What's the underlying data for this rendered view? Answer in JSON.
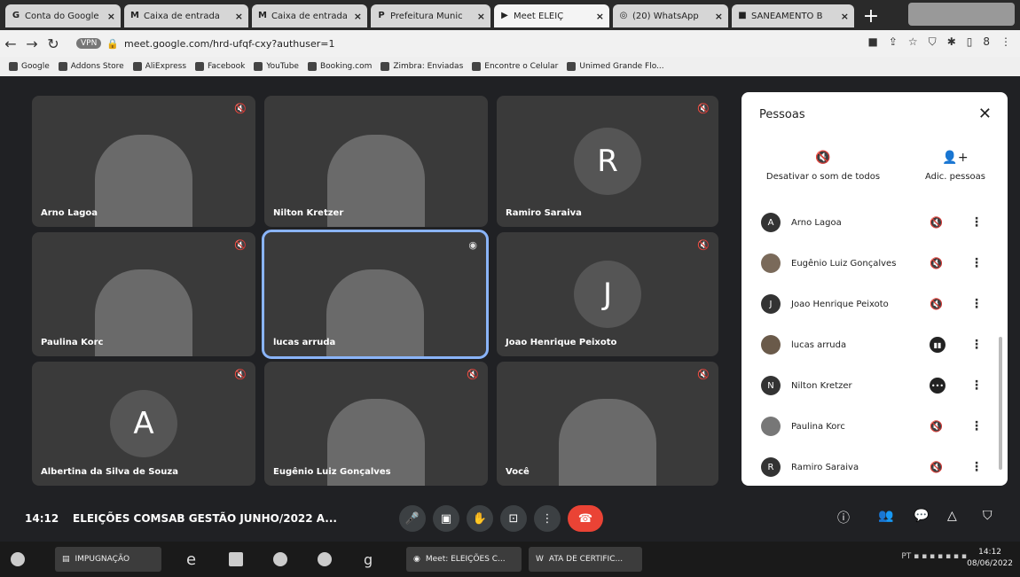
{
  "tabs": [
    {
      "label": "Conta do Google",
      "icon": "G",
      "active": false
    },
    {
      "label": "Caixa de entrada",
      "icon": "M",
      "active": false
    },
    {
      "label": "Caixa de entrada",
      "icon": "M",
      "active": false
    },
    {
      "label": "Prefeitura Munic",
      "icon": "P",
      "active": false
    },
    {
      "label": "Meet ELEIÇ",
      "icon": "▶",
      "active": true
    },
    {
      "label": "(20) WhatsApp",
      "icon": "◎",
      "active": false
    },
    {
      "label": "SANEAMENTO B",
      "icon": "■",
      "active": false
    }
  ],
  "address": {
    "vpn": "VPN",
    "url": "meet.google.com/hrd-ufqf-cxy?authuser=1"
  },
  "bookmarks": [
    "Google",
    "Addons Store",
    "AliExpress",
    "Facebook",
    "YouTube",
    "Booking.com",
    "Zimbra: Enviadas",
    "Encontre o Celular",
    "Unimed Grande Flo..."
  ],
  "tiles": [
    {
      "name": "Arno Lagoa",
      "initial": ""
    },
    {
      "name": "Nilton Kretzer",
      "initial": ""
    },
    {
      "name": "Ramiro Saraiva",
      "initial": "R"
    },
    {
      "name": "Paulina Korc",
      "initial": ""
    },
    {
      "name": "lucas arruda",
      "initial": ""
    },
    {
      "name": "Joao Henrique Peixoto",
      "initial": "J"
    },
    {
      "name": "Albertina da Silva de Souza",
      "initial": "A"
    },
    {
      "name": "Eugênio Luiz Gonçalves",
      "initial": ""
    },
    {
      "name": "Você",
      "initial": ""
    }
  ],
  "panel": {
    "title": "Pessoas",
    "mute_all": "Desativar o som de todos",
    "add_people": "Adic. pessoas",
    "people": [
      {
        "name": "Arno Lagoa",
        "avatar": "A",
        "status": "muted"
      },
      {
        "name": "Eugênio Luiz Gonçalves",
        "avatar": "",
        "status": "muted"
      },
      {
        "name": "Joao Henrique Peixoto",
        "avatar": "J",
        "status": "muted"
      },
      {
        "name": "lucas arruda",
        "avatar": "",
        "status": "speaking"
      },
      {
        "name": "Nilton Kretzer",
        "avatar": "N",
        "status": "active"
      },
      {
        "name": "Paulina Korc",
        "avatar": "",
        "status": "muted"
      },
      {
        "name": "Ramiro Saraiva",
        "avatar": "R",
        "status": "muted"
      }
    ]
  },
  "bottom": {
    "clock": "14:12",
    "meeting": "ELEIÇÕES COMSAB GESTÃO JUNHO/2022 A..."
  },
  "taskbar": {
    "items": [
      "IMPUGNAÇÃO",
      "Meet: ELEIÇÕES C...",
      "ATA DE CERTIFIC..."
    ],
    "tray": "PT",
    "time": "14:12",
    "date": "08/06/2022"
  }
}
